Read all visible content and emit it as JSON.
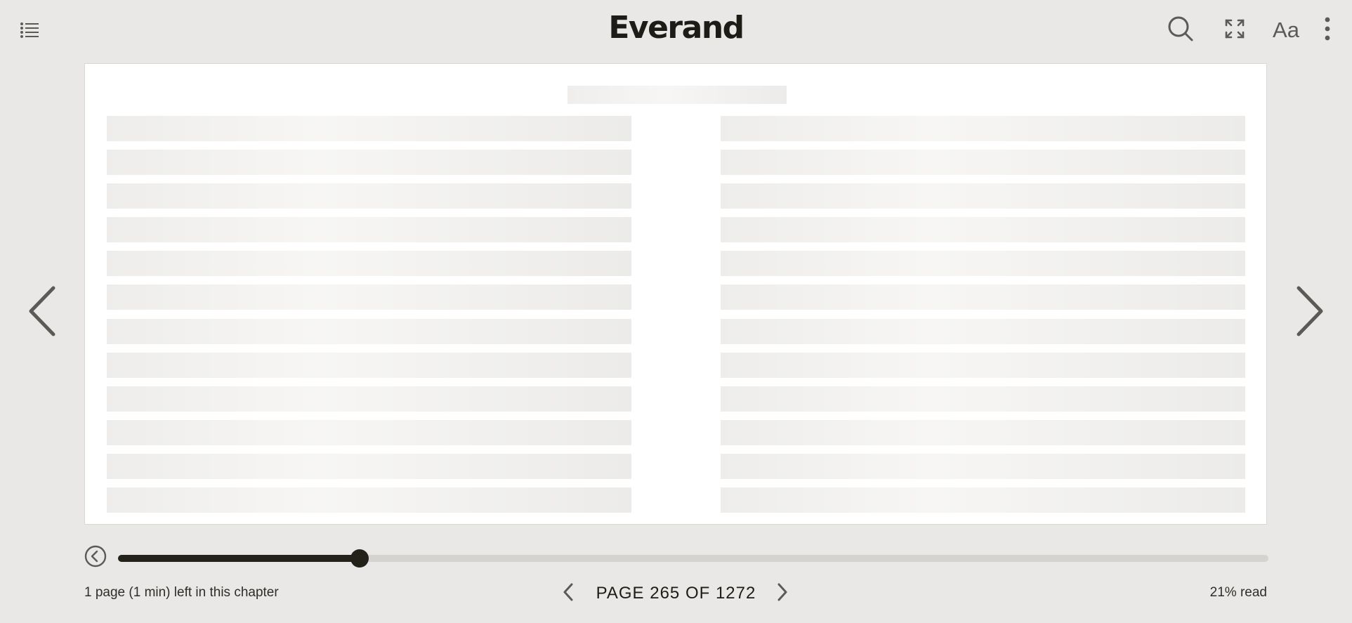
{
  "app": {
    "logo_text": "Everand"
  },
  "toolbar": {
    "icons": [
      "list-icon",
      "search-icon",
      "fullscreen-icon",
      "font-settings-icon",
      "more-vertical-icon"
    ],
    "font_settings_label": "Aa"
  },
  "book": {
    "loading": true,
    "lines_per_column": 12,
    "columns": 2
  },
  "progress": {
    "percent_read": 21,
    "read_label": "21% read",
    "chapter_remaining": "1 page (1 min) left in this chapter"
  },
  "pager": {
    "label": "PAGE 265 OF 1272",
    "current_page": 265,
    "total_pages": 1272
  },
  "colors": {
    "background": "#e9e8e6",
    "page": "#ffffff",
    "accent": "#24211b",
    "track": "#d4d3d0",
    "icon": "#5b5a57"
  }
}
